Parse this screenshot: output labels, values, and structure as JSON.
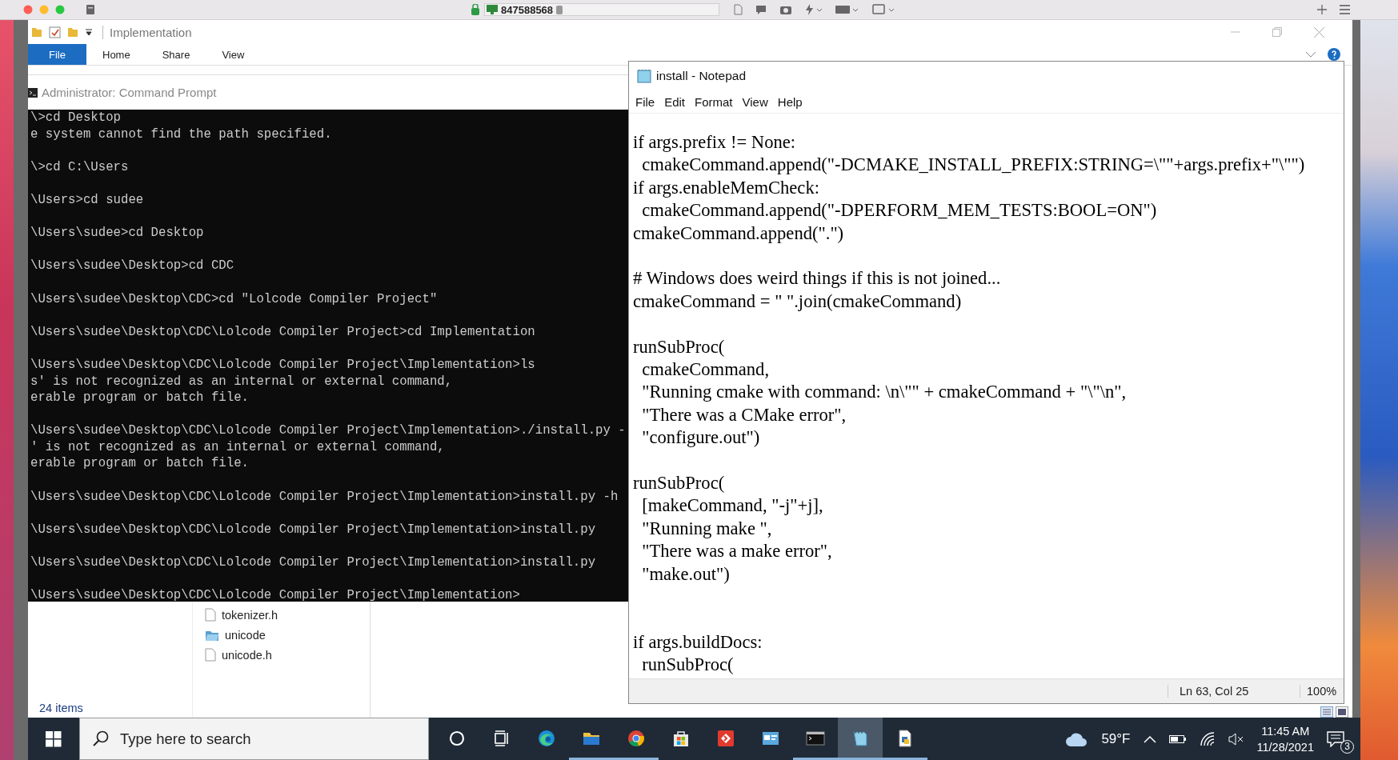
{
  "host_bar": {
    "session_id": "847588568"
  },
  "explorer": {
    "title": "Implementation",
    "ribbon_tabs": [
      {
        "label": "File",
        "kind": "backstage"
      },
      {
        "label": "Home",
        "kind": "tab"
      },
      {
        "label": "Share",
        "kind": "tab"
      },
      {
        "label": "View",
        "kind": "tab"
      }
    ],
    "files": [
      {
        "name": "tokenizer.h",
        "kind": "file"
      },
      {
        "name": "unicode",
        "kind": "folder"
      },
      {
        "name": "unicode.h",
        "kind": "file"
      }
    ],
    "status": "24 items"
  },
  "command_prompt": {
    "title": "Administrator: Command Prompt",
    "blocks": [
      [
        "\\>cd Desktop",
        "e system cannot find the path specified."
      ],
      [
        "\\>cd C:\\Users"
      ],
      [
        "\\Users>cd sudee"
      ],
      [
        "\\Users\\sudee>cd Desktop"
      ],
      [
        "\\Users\\sudee\\Desktop>cd CDC"
      ],
      [
        "\\Users\\sudee\\Desktop\\CDC>cd \"Lolcode Compiler Project\""
      ],
      [
        "\\Users\\sudee\\Desktop\\CDC\\Lolcode Compiler Project>cd Implementation"
      ],
      [
        "\\Users\\sudee\\Desktop\\CDC\\Lolcode Compiler Project\\Implementation>ls",
        "s' is not recognized as an internal or external command,",
        "erable program or batch file."
      ],
      [
        "\\Users\\sudee\\Desktop\\CDC\\Lolcode Compiler Project\\Implementation>./install.py -",
        "' is not recognized as an internal or external command,",
        "erable program or batch file."
      ],
      [
        "\\Users\\sudee\\Desktop\\CDC\\Lolcode Compiler Project\\Implementation>install.py -h"
      ],
      [
        "\\Users\\sudee\\Desktop\\CDC\\Lolcode Compiler Project\\Implementation>install.py"
      ],
      [
        "\\Users\\sudee\\Desktop\\CDC\\Lolcode Compiler Project\\Implementation>install.py"
      ],
      [
        "\\Users\\sudee\\Desktop\\CDC\\Lolcode Compiler Project\\Implementation>"
      ]
    ]
  },
  "notepad": {
    "title": "install - Notepad",
    "menu": [
      "File",
      "Edit",
      "Format",
      "View",
      "Help"
    ],
    "blocks": [
      [
        "if args.prefix != None:",
        "  cmakeCommand.append(\"-DCMAKE_INSTALL_PREFIX:STRING=\\\"\"+args.prefix+\"\\\"\")",
        "if args.enableMemCheck:",
        "  cmakeCommand.append(\"-DPERFORM_MEM_TESTS:BOOL=ON\")",
        "cmakeCommand.append(\".\")"
      ],
      [
        "# Windows does weird things if this is not joined...",
        "cmakeCommand = \" \".join(cmakeCommand)"
      ],
      [
        "runSubProc(",
        "  cmakeCommand,",
        "  \"Running cmake with command: \\n\\\"\" + cmakeCommand + \"\\\"\\n\",",
        "  \"There was a CMake error\",",
        "  \"configure.out\")"
      ],
      [
        "runSubProc(",
        "  [makeCommand, \"-j\"+j],",
        "  \"Running make \",",
        "  \"There was a make error\",",
        "  \"make.out\")"
      ],
      [
        "if args.buildDocs:",
        "  runSubProc("
      ]
    ],
    "position": "Ln 63, Col 25",
    "zoom": "100%"
  },
  "taskbar": {
    "search_placeholder": "Type here to search",
    "apps": [
      {
        "kind": "ring",
        "running": false,
        "active": false
      },
      {
        "kind": "taskview",
        "running": false,
        "active": false
      },
      {
        "kind": "edge",
        "running": false,
        "active": false
      },
      {
        "kind": "folder",
        "running": true,
        "active": false
      },
      {
        "kind": "chrome",
        "running": true,
        "active": false
      },
      {
        "kind": "store",
        "running": false,
        "active": false
      },
      {
        "kind": "red",
        "running": false,
        "active": false
      },
      {
        "kind": "card",
        "running": false,
        "active": false
      },
      {
        "kind": "terminal",
        "running": true,
        "active": false
      },
      {
        "kind": "notepad",
        "running": true,
        "active": true
      },
      {
        "kind": "document",
        "running": true,
        "active": false
      }
    ],
    "temperature": "59°F",
    "time": "11:45 AM",
    "date": "11/28/2021",
    "notifications": "3"
  }
}
